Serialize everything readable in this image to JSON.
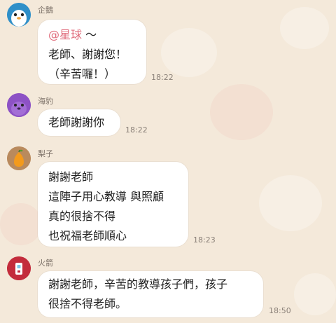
{
  "messages": [
    {
      "sender": "企鵝",
      "mention": "@星球",
      "mention_suffix": " 〜",
      "lines": [
        "老師、謝謝您！",
        "（辛苦囉！）"
      ],
      "time": "18:22",
      "avatar_icon": "penguin-icon"
    },
    {
      "sender": "海豹",
      "lines": [
        "老師謝謝你"
      ],
      "time": "18:22",
      "avatar_icon": "seal-icon"
    },
    {
      "sender": "梨子",
      "lines": [
        "謝謝老師",
        "這陣子用心教導 與照顧",
        "真的很捨不得",
        "也祝福老師順心"
      ],
      "time": "18:23",
      "avatar_icon": "pear-icon"
    },
    {
      "sender": "火箭",
      "lines": [
        "謝謝老師，辛苦的教導孩子們，孩子",
        "很捨不得老師。"
      ],
      "time": "18:50",
      "avatar_icon": "rocket-icon"
    }
  ]
}
